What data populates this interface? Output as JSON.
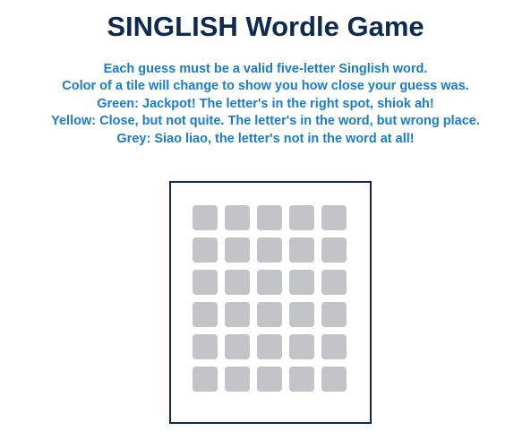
{
  "header": {
    "title": "SINGLISH Wordle Game"
  },
  "instructions": {
    "lines": [
      "Each guess must be a valid five-letter Singlish word.",
      "Color of a tile will change to show you how close your guess was.",
      "Green: Jackpot! The letter's in the right spot, shiok ah!",
      "Yellow: Close, but not quite. The letter's in the word, but wrong place.",
      "Grey: Siao liao, the letter's not in the word at all!"
    ]
  },
  "board": {
    "rows": 6,
    "cols": 5,
    "tiles": [
      [
        "",
        "",
        "",
        "",
        ""
      ],
      [
        "",
        "",
        "",
        "",
        ""
      ],
      [
        "",
        "",
        "",
        "",
        ""
      ],
      [
        "",
        "",
        "",
        "",
        ""
      ],
      [
        "",
        "",
        "",
        "",
        ""
      ],
      [
        "",
        "",
        "",
        "",
        ""
      ]
    ]
  },
  "colors": {
    "title": "#0d2a52",
    "instructions": "#1a7ccf",
    "board_border": "#0d2a52",
    "empty_tile": "#c2c3c6"
  }
}
